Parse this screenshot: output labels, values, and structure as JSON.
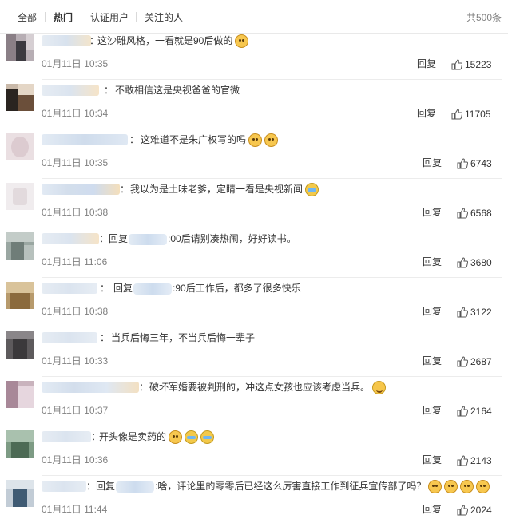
{
  "tabs": [
    {
      "label": "全部"
    },
    {
      "label": "热门"
    },
    {
      "label": "认证用户"
    },
    {
      "label": "关注的人"
    }
  ],
  "total": "共500条",
  "actions": {
    "reply_label": "回复"
  },
  "comments": [
    {
      "text": "这沙雕风格，一看就是90后做的",
      "time": "01月11日 10:35",
      "likes": "15223"
    },
    {
      "text": "不敢相信这是央视爸爸的官微",
      "time": "01月11日 10:34",
      "likes": "11705"
    },
    {
      "text": "这难道不是朱广权写的吗",
      "time": "01月11日 10:35",
      "likes": "6743"
    },
    {
      "text": "我以为是土味老爹，定睛一看是央视新闻",
      "time": "01月11日 10:38",
      "likes": "6568"
    },
    {
      "reply_prefix": "回复",
      "text": ":00后请别凑热闹，好好读书。",
      "time": "01月11日 11:06",
      "likes": "3680"
    },
    {
      "reply_prefix": "回复",
      "text": ":90后工作后，都多了很多快乐",
      "time": "01月11日 10:38",
      "likes": "3122"
    },
    {
      "text": "当兵后悔三年，不当兵后悔一辈子",
      "time": "01月11日 10:33",
      "likes": "2687"
    },
    {
      "text": "破坏军婚要被判刑的，冲这点女孩也应该考虑当兵。",
      "time": "01月11日 10:37",
      "likes": "2164"
    },
    {
      "text": "开头像是卖药的",
      "time": "01月11日 10:36",
      "likes": "2143"
    },
    {
      "reply_prefix": "回复",
      "text": ":啥，评论里的零零后已经这么厉害直接工作到征兵宣传部了吗？",
      "time": "01月11日 11:44",
      "likes": "2024"
    }
  ],
  "colors": {
    "text": "#333333",
    "meta": "#808080",
    "divider": "#ececec"
  },
  "icons": {
    "like": "thumbs-up-icon",
    "emoticons": [
      "doge-emoji",
      "laugh-cry-emoji",
      "smile-emoji"
    ]
  }
}
